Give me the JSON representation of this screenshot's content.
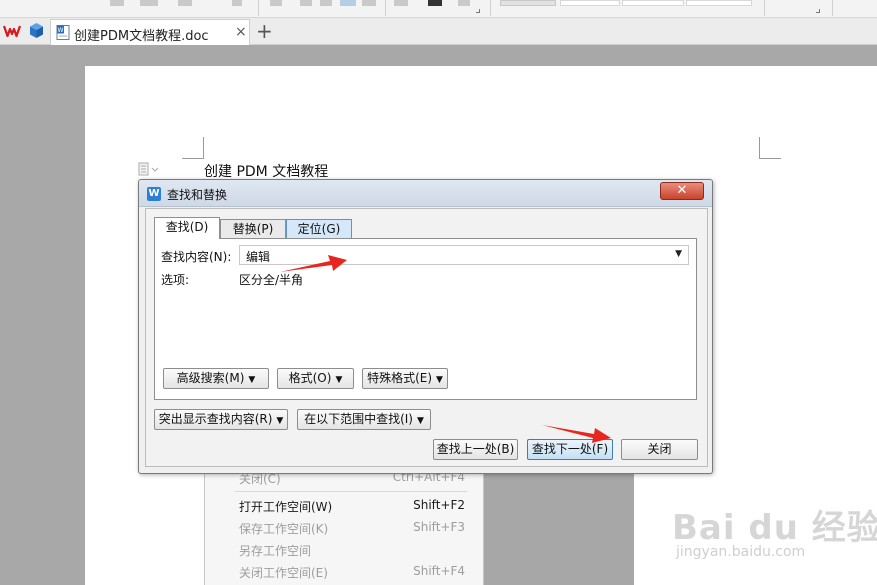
{
  "tabbar": {
    "document_tab": "创建PDM文档教程.doc",
    "close_glyph": "×",
    "new_tab_glyph": "+"
  },
  "document": {
    "heading": "创建 PDM 文档教程"
  },
  "background_menu": {
    "items": [
      {
        "label": "关闭(C)",
        "shortcut": "Ctrl+Alt+F4",
        "enabled": false
      },
      {
        "label": "打开工作空间(W)",
        "shortcut": "Shift+F2",
        "enabled": true
      },
      {
        "label": "保存工作空间(K)",
        "shortcut": "Shift+F3",
        "enabled": false
      },
      {
        "label": "另存工作空间",
        "shortcut": "",
        "enabled": false
      },
      {
        "label": "关闭工作空间(E)",
        "shortcut": "Shift+F4",
        "enabled": false
      }
    ]
  },
  "dialog": {
    "title": "查找和替换",
    "icon_letter": "W",
    "close_glyph": "✕",
    "tabs": [
      {
        "label": "查找(D)",
        "active": true
      },
      {
        "label": "替换(P)",
        "active": false
      },
      {
        "label": "定位(G)",
        "active": false
      }
    ],
    "find_label": "查找内容(N):",
    "find_value": "编辑",
    "options_label": "选项:",
    "options_value": "区分全/半角",
    "panel_buttons": {
      "advanced": "高级搜索(M)",
      "format": "格式(O)",
      "special": "特殊格式(E)"
    },
    "lower_buttons": {
      "highlight": "突出显示查找内容(R)",
      "find_in": "在以下范围中查找(I)"
    },
    "action_buttons": {
      "find_prev": "查找上一处(B)",
      "find_next": "查找下一处(F)",
      "close": "关闭"
    },
    "dropdown_glyph": "▼"
  },
  "watermark": {
    "logo": "Bai du 经验",
    "url": "jingyan.baidu.com"
  },
  "colors": {
    "annotation_arrow": "#e8261f",
    "accent_blue": "#2c7fd6",
    "close_red": "#c9422b"
  }
}
